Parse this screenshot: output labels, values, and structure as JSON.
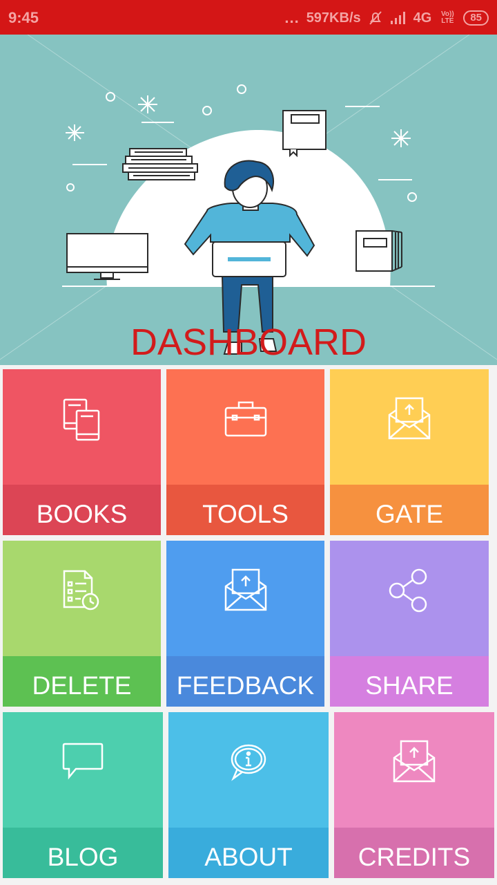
{
  "status_bar": {
    "time": "9:45",
    "dots": "...",
    "speed": "597KB/s",
    "network": "4G",
    "volte": "Vo)) LTE",
    "battery": "85"
  },
  "hero": {
    "title": "DASHBOARD"
  },
  "tiles": [
    {
      "label": "BOOKS",
      "icon": "books-icon",
      "top_color": "#ef5563",
      "bottom_color": "#dc4555"
    },
    {
      "label": "TOOLS",
      "icon": "briefcase-icon",
      "top_color": "#fd7152",
      "bottom_color": "#e8573f"
    },
    {
      "label": "GATE",
      "icon": "mail-upload-icon",
      "top_color": "#ffce54",
      "bottom_color": "#f6913f"
    },
    {
      "label": "DELETE",
      "icon": "document-timer-icon",
      "top_color": "#a8d86d",
      "bottom_color": "#5dc152"
    },
    {
      "label": "FEEDBACK",
      "icon": "mail-upload-icon",
      "top_color": "#4f9def",
      "bottom_color": "#4a89dc"
    },
    {
      "label": "SHARE",
      "icon": "share-icon",
      "top_color": "#ac92ed",
      "bottom_color": "#d57fe0"
    },
    {
      "label": "BLOG",
      "icon": "chat-bubble-icon",
      "top_color": "#4dcfae",
      "bottom_color": "#38bc9a"
    },
    {
      "label": "ABOUT",
      "icon": "info-bubble-icon",
      "top_color": "#4cbfe8",
      "bottom_color": "#39acdc"
    },
    {
      "label": "CREDITS",
      "icon": "mail-upload-icon",
      "top_color": "#ee88c0",
      "bottom_color": "#d770ad"
    }
  ]
}
